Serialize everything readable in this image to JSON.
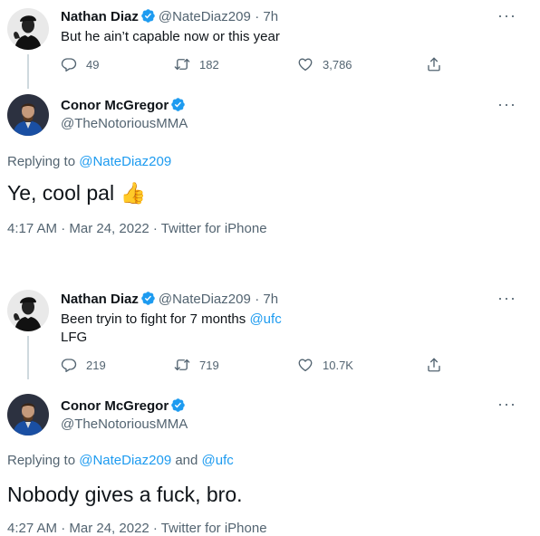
{
  "tweet1": {
    "author": {
      "name": "Nathan Diaz",
      "handle": "@NateDiaz209",
      "time": "· 7h"
    },
    "text": "But he ain’t capable now or this year",
    "replies": "49",
    "retweets": "182",
    "likes": "3,786"
  },
  "reply1": {
    "author": {
      "name": "Conor McGregor",
      "handle": "@TheNotoriousMMA"
    },
    "replying_prefix": "Replying to",
    "replying_to": "@NateDiaz209",
    "text": "Ye, cool pal",
    "emoji": "👍",
    "meta": "4:17 AM · Mar 24, 2022 · Twitter for iPhone"
  },
  "tweet2": {
    "author": {
      "name": "Nathan Diaz",
      "handle": "@NateDiaz209",
      "time": "· 7h"
    },
    "text_line1_prefix": "Been tryin to fight for 7 months",
    "text_line1_link": "@ufc",
    "text_line2": "LFG",
    "replies": "219",
    "retweets": "719",
    "likes": "10.7K"
  },
  "reply2": {
    "author": {
      "name": "Conor McGregor",
      "handle": "@TheNotoriousMMA"
    },
    "replying_prefix": "Replying to",
    "replying_to1": "@NateDiaz209",
    "and": "and",
    "replying_to2": "@ufc",
    "text": "Nobody gives a fuck, bro.",
    "meta": "4:27 AM · Mar 24, 2022 · Twitter for iPhone"
  },
  "icons": {
    "verified": "verified-badge",
    "more": "more-icon",
    "reply": "reply-icon",
    "retweet": "retweet-icon",
    "like": "like-icon",
    "share": "share-icon"
  },
  "colors": {
    "accent": "#1d9bf0",
    "muted": "#536471",
    "text": "#0f1419",
    "divider": "#cfd9de"
  }
}
